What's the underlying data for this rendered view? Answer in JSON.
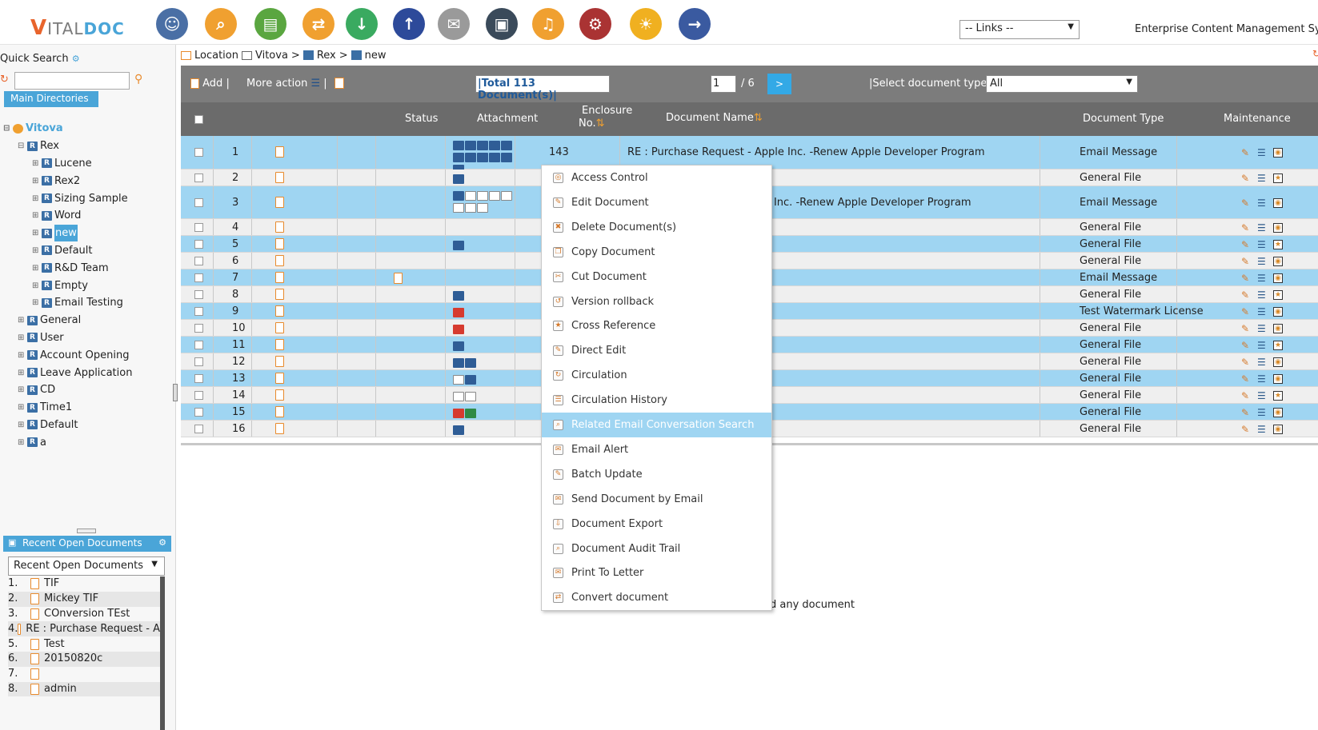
{
  "topbar": {
    "logo_v": "V",
    "logo_ital": "ITAL",
    "logo_doc": "DOC",
    "links_select": "-- Links --",
    "app_title": "Enterprise Content Management Syst",
    "icons": [
      {
        "name": "user-admin-icon",
        "glyph": "☺",
        "color": "#4a6fa5"
      },
      {
        "name": "search-icon",
        "glyph": "⌕",
        "color": "#f0a030"
      },
      {
        "name": "documents-icon",
        "glyph": "▤",
        "color": "#5aa640"
      },
      {
        "name": "workflow-icon",
        "glyph": "⇄",
        "color": "#f0a030"
      },
      {
        "name": "download-icon",
        "glyph": "↓",
        "color": "#3aaa60"
      },
      {
        "name": "upload-icon",
        "glyph": "↑",
        "color": "#2d4a9a"
      },
      {
        "name": "mail-icon",
        "glyph": "✉",
        "color": "#9a9a9a"
      },
      {
        "name": "archive-icon",
        "glyph": "▣",
        "color": "#3a4a5a"
      },
      {
        "name": "bell-icon",
        "glyph": "♫",
        "color": "#f0a030"
      },
      {
        "name": "report-icon",
        "glyph": "⚙",
        "color": "#aa3333"
      },
      {
        "name": "lightbulb-icon",
        "glyph": "☀",
        "color": "#f0b020"
      },
      {
        "name": "logout-icon",
        "glyph": "→",
        "color": "#3a5aa0"
      }
    ]
  },
  "sidebar": {
    "quick_search_label": "Quick Search",
    "main_directories_label": "Main Directories",
    "tree": [
      {
        "label": "Vitova",
        "level": 0,
        "root": true,
        "selected": false
      },
      {
        "label": "Rex",
        "level": 1,
        "root": false,
        "selected": false
      },
      {
        "label": "Lucene",
        "level": 2,
        "root": false,
        "selected": false
      },
      {
        "label": "Rex2",
        "level": 2,
        "root": false,
        "selected": false
      },
      {
        "label": "Sizing Sample",
        "level": 2,
        "root": false,
        "selected": false
      },
      {
        "label": "Word",
        "level": 2,
        "root": false,
        "selected": false
      },
      {
        "label": "new",
        "level": 2,
        "root": false,
        "selected": true
      },
      {
        "label": "Default",
        "level": 2,
        "root": false,
        "selected": false
      },
      {
        "label": "R&D Team",
        "level": 2,
        "root": false,
        "selected": false
      },
      {
        "label": "Empty",
        "level": 2,
        "root": false,
        "selected": false
      },
      {
        "label": "Email Testing",
        "level": 2,
        "root": false,
        "selected": false
      },
      {
        "label": "General",
        "level": 1,
        "root": false,
        "selected": false
      },
      {
        "label": "User",
        "level": 1,
        "root": false,
        "selected": false
      },
      {
        "label": "Account Opening",
        "level": 1,
        "root": false,
        "selected": false
      },
      {
        "label": "Leave Application",
        "level": 1,
        "root": false,
        "selected": false
      },
      {
        "label": "CD",
        "level": 1,
        "root": false,
        "selected": false
      },
      {
        "label": "Time1",
        "level": 1,
        "root": false,
        "selected": false
      },
      {
        "label": "Default",
        "level": 1,
        "root": false,
        "selected": false
      },
      {
        "label": "a",
        "level": 1,
        "root": false,
        "selected": false
      }
    ],
    "recent_header": "Recent Open Documents",
    "recent_select": "Recent Open Documents",
    "recent_items": [
      {
        "num": "1.",
        "label": "TIF"
      },
      {
        "num": "2.",
        "label": "Mickey TIF"
      },
      {
        "num": "3.",
        "label": "COnversion TEst"
      },
      {
        "num": "4.",
        "label": "RE : Purchase Request - A"
      },
      {
        "num": "5.",
        "label": "Test"
      },
      {
        "num": "6.",
        "label": "20150820c"
      },
      {
        "num": "7.",
        "label": ""
      },
      {
        "num": "8.",
        "label": "admin"
      }
    ]
  },
  "breadcrumb": {
    "location_label": "Location",
    "items": [
      "Vitova",
      "Rex",
      "new"
    ],
    "separator": ">"
  },
  "toolbar": {
    "add_label": "Add |",
    "more_action_label": "More action",
    "total_label": "|Total 113 Document(s)|",
    "page_value": "1",
    "page_total": "/ 6",
    "go_label": ">",
    "doctype_label": "|Select document type:",
    "doctype_value": "All"
  },
  "table": {
    "headers": {
      "status": "Status",
      "attachment": "Attachment",
      "enclosure_line1": "Enclosure",
      "enclosure_line2": "No.",
      "document_name": "Document Name",
      "document_type": "Document Type",
      "maintenance": "Maintenance"
    },
    "rows": [
      {
        "no": "1",
        "enclosure": "143",
        "name": "RE : Purchase Request - Apple Inc. -Renew Apple Developer Program",
        "type": "Email Message",
        "blue": true,
        "height": 42
      },
      {
        "no": "2",
        "enclosure": "",
        "name": "",
        "type": "General File",
        "blue": false,
        "height": 21
      },
      {
        "no": "3",
        "enclosure": "",
        "name": "- Apple Inc. -Renew Apple Developer Program",
        "type": "Email Message",
        "blue": true,
        "height": 41
      },
      {
        "no": "4",
        "enclosure": "",
        "name": "",
        "type": "General File",
        "blue": false,
        "height": 21
      },
      {
        "no": "5",
        "enclosure": "",
        "name": "",
        "type": "General File",
        "blue": true,
        "height": 21
      },
      {
        "no": "6",
        "enclosure": "",
        "name": "",
        "type": "General File",
        "blue": false,
        "height": 21
      },
      {
        "no": "7",
        "enclosure": "",
        "name": "",
        "type": "Email Message",
        "blue": true,
        "height": 21
      },
      {
        "no": "8",
        "enclosure": "",
        "name": "",
        "type": "General File",
        "blue": false,
        "height": 21
      },
      {
        "no": "9",
        "enclosure": "",
        "name": "",
        "type": "Test Watermark License",
        "blue": true,
        "height": 21
      },
      {
        "no": "10",
        "enclosure": "",
        "name": "",
        "type": "General File",
        "blue": false,
        "height": 21
      },
      {
        "no": "11",
        "enclosure": "",
        "name": "",
        "type": "General File",
        "blue": true,
        "height": 21
      },
      {
        "no": "12",
        "enclosure": "",
        "name": "",
        "type": "General File",
        "blue": false,
        "height": 21
      },
      {
        "no": "13",
        "enclosure": "",
        "name": "",
        "type": "General File",
        "blue": true,
        "height": 21
      },
      {
        "no": "14",
        "enclosure": "",
        "name": "",
        "type": "General File",
        "blue": false,
        "height": 21
      },
      {
        "no": "15",
        "enclosure": "",
        "name": "",
        "type": "General File",
        "blue": true,
        "height": 21
      },
      {
        "no": "16",
        "enclosure": "",
        "name": "",
        "type": "General File",
        "blue": false,
        "height": 21
      }
    ]
  },
  "context_menu": {
    "items": [
      {
        "label": "Access Control",
        "highlight": false
      },
      {
        "label": "Edit Document",
        "highlight": false
      },
      {
        "label": "Delete Document(s)",
        "highlight": false
      },
      {
        "label": "Copy Document",
        "highlight": false
      },
      {
        "label": "Cut Document",
        "highlight": false
      },
      {
        "label": "Version rollback",
        "highlight": false
      },
      {
        "label": "Cross Reference",
        "highlight": false
      },
      {
        "label": "Direct Edit",
        "highlight": false
      },
      {
        "label": "Circulation",
        "highlight": false
      },
      {
        "label": "Circulation History",
        "highlight": false
      },
      {
        "label": "Related Email Conversation Search",
        "highlight": true
      },
      {
        "label": "Email Alert",
        "highlight": false
      },
      {
        "label": "Batch Update",
        "highlight": false
      },
      {
        "label": "Send Document by Email",
        "highlight": false
      },
      {
        "label": "Document Export",
        "highlight": false
      },
      {
        "label": "Document Audit Trail",
        "highlight": false
      },
      {
        "label": "Print To Letter",
        "highlight": false
      },
      {
        "label": "Convert document",
        "highlight": false
      }
    ]
  },
  "empty_message": "d any document",
  "colors": {
    "accent": "#4aa5d8",
    "row_blue": "#9fd5f2",
    "toolbar": "#7c7c7c",
    "header": "#6b6b6b"
  }
}
